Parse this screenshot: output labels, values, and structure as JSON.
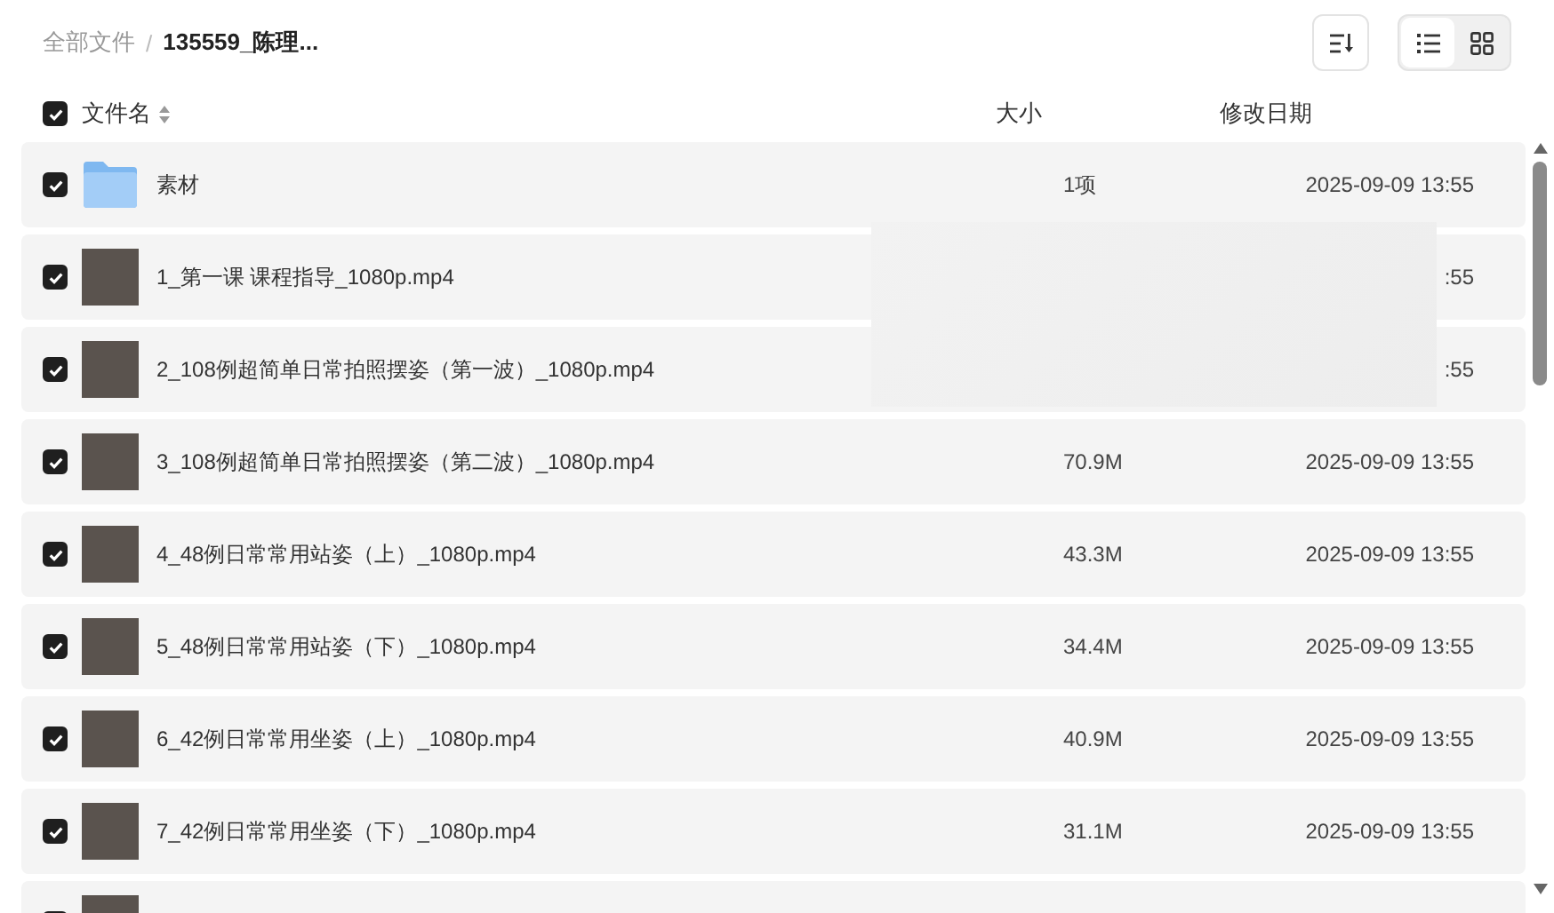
{
  "breadcrumb_separator": "/",
  "breadcrumb": [
    {
      "label": "全部文件",
      "current": false
    },
    {
      "label": "135559_陈理...",
      "current": true
    }
  ],
  "view_modes": [
    {
      "kind": "list",
      "selected": true
    },
    {
      "kind": "grid",
      "selected": false
    }
  ],
  "table": {
    "select_all": {
      "checked": true
    },
    "columns": [
      {
        "label": "文件名",
        "sortable": true
      },
      {
        "label": "大小",
        "sortable": false
      },
      {
        "label": "修改日期",
        "sortable": false
      }
    ],
    "rows": [
      {
        "kind": "folder",
        "checked": true,
        "name": "素材",
        "size": "1项",
        "date": "2025-09-09 13:55"
      },
      {
        "kind": "video",
        "checked": true,
        "name": "1_第一课 课程指导_1080p.mp4",
        "date": ":55"
      },
      {
        "kind": "video",
        "checked": true,
        "name": "2_108例超简单日常拍照摆姿（第一波）_1080p.mp4",
        "date": ":55"
      },
      {
        "kind": "video",
        "checked": true,
        "name": "3_108例超简单日常拍照摆姿（第二波）_1080p.mp4",
        "size": "70.9M",
        "date": "2025-09-09 13:55"
      },
      {
        "kind": "video",
        "checked": true,
        "name": "4_48例日常常用站姿（上）_1080p.mp4",
        "size": "43.3M",
        "date": "2025-09-09 13:55"
      },
      {
        "kind": "video",
        "checked": true,
        "name": "5_48例日常常用站姿（下）_1080p.mp4",
        "size": "34.4M",
        "date": "2025-09-09 13:55"
      },
      {
        "kind": "video",
        "checked": true,
        "name": "6_42例日常常用坐姿（上）_1080p.mp4",
        "size": "40.9M",
        "date": "2025-09-09 13:55"
      },
      {
        "kind": "video",
        "checked": true,
        "name": "7_42例日常常用坐姿（下）_1080p.mp4",
        "size": "31.1M",
        "date": "2025-09-09 13:55"
      },
      {
        "kind": "video",
        "checked": true
      }
    ]
  }
}
